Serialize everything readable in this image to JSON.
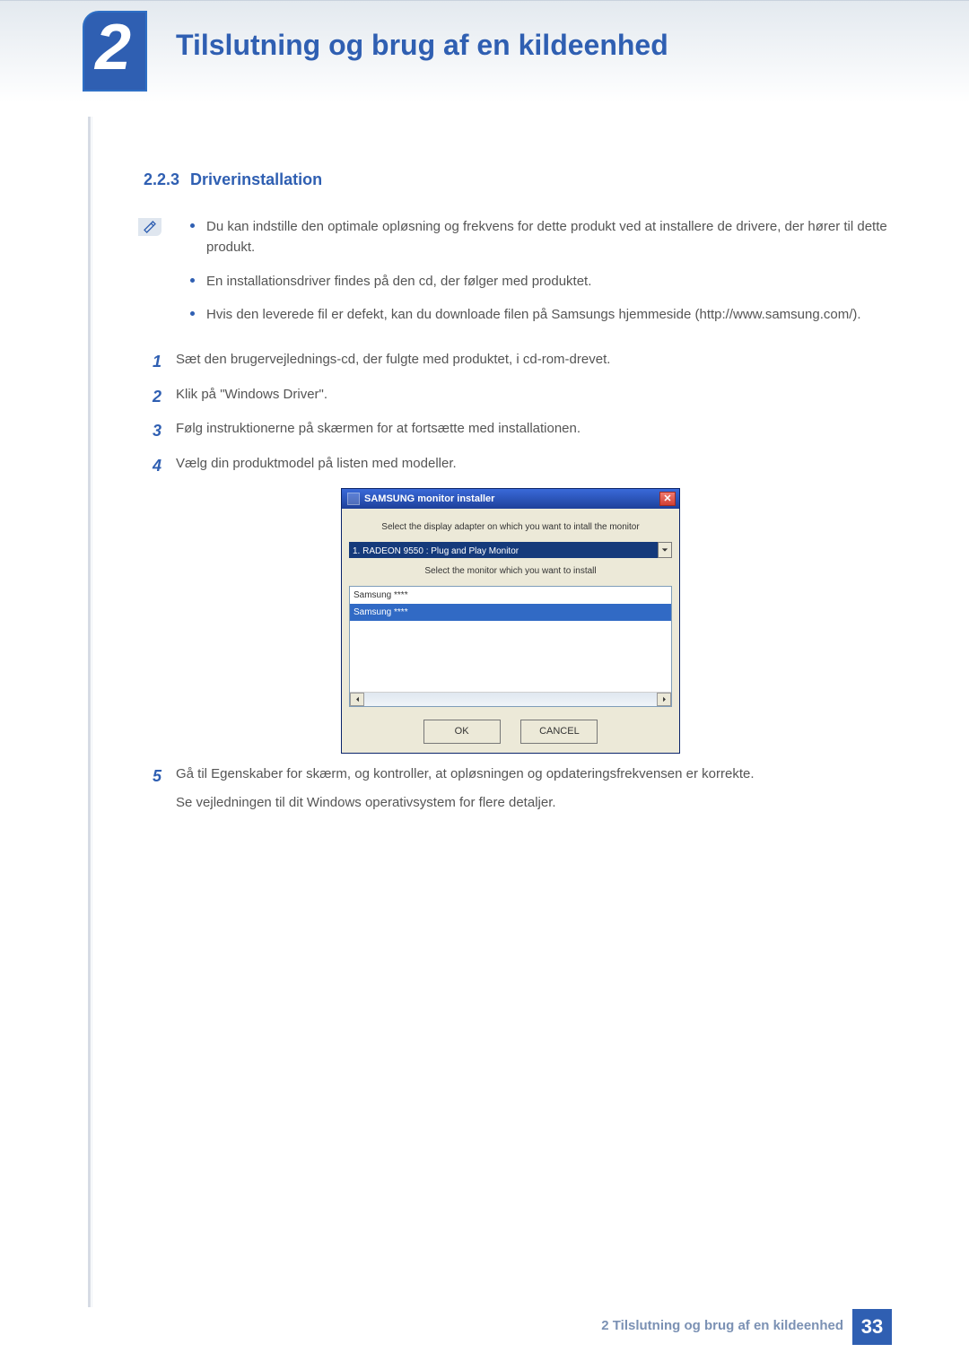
{
  "chapter": {
    "number": "2",
    "title": "Tilslutning og brug af en kildeenhed"
  },
  "section": {
    "number": "2.2.3",
    "title": "Driverinstallation"
  },
  "note_bullets": [
    "Du kan indstille den optimale opløsning og frekvens for dette produkt ved at installere de drivere, der hører til dette produkt.",
    "En installationsdriver findes på den cd, der følger med produktet.",
    "Hvis den leverede fil er defekt, kan du downloade filen på Samsungs hjemmeside (http://www.samsung.com/)."
  ],
  "steps": [
    {
      "n": "1",
      "text": "Sæt den brugervejlednings-cd, der fulgte med produktet, i cd-rom-drevet."
    },
    {
      "n": "2",
      "text": "Klik på \"Windows Driver\"."
    },
    {
      "n": "3",
      "text": "Følg instruktionerne på skærmen for at fortsætte med installationen."
    },
    {
      "n": "4",
      "text": "Vælg din produktmodel på listen med modeller."
    }
  ],
  "installer": {
    "title": "SAMSUNG monitor installer",
    "label_adapter": "Select the display adapter on which you want to intall the monitor",
    "combo_value": "1. RADEON 9550 : Plug and Play Monitor",
    "label_monitor": "Select the monitor which you want to install",
    "list_rows": [
      "Samsung ****",
      "Samsung ****"
    ],
    "ok": "OK",
    "cancel": "CANCEL"
  },
  "step5": {
    "n": "5",
    "line1": "Gå til Egenskaber for skærm, og kontroller, at opløsningen og opdateringsfrekvensen er korrekte.",
    "line2": "Se vejledningen til dit Windows operativsystem for flere detaljer."
  },
  "footer": {
    "text": "2 Tilslutning og brug af en kildeenhed",
    "page": "33"
  }
}
